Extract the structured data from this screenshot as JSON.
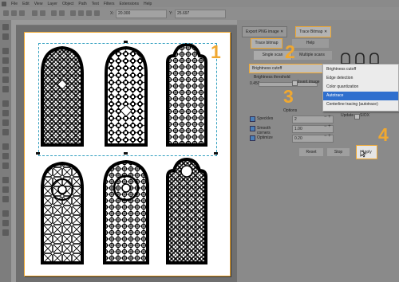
{
  "menu": {
    "items": [
      "File",
      "Edit",
      "View",
      "Layer",
      "Object",
      "Path",
      "Text",
      "Filters",
      "Extensions",
      "Help"
    ]
  },
  "toolbar": {
    "x_label": "X:",
    "x_value": "20.000",
    "y_label": "Y:",
    "y_value": "25.697"
  },
  "panel": {
    "tabs": [
      {
        "label": "Export PNG image",
        "close": "✕"
      },
      {
        "label": "Trace Bitmap",
        "close": "✕"
      }
    ],
    "subtabs": {
      "trace": "Trace bitmap",
      "help": "Help"
    },
    "scan_buttons": {
      "single": "Single scan",
      "multiple": "Multiple scans"
    },
    "mode_selected": "Brightness cutoff",
    "brightness_label": "Brightness threshold",
    "threshold_value": "0.450",
    "invert_label": "Invert image",
    "options_label": "Options",
    "options": [
      {
        "label": "Speckles",
        "value": "2"
      },
      {
        "label": "Smooth corners",
        "value": "1.00"
      },
      {
        "label": "Optimize",
        "value": "0.20"
      }
    ],
    "dropdown_options": [
      "Brightness cutoff",
      "Edge detection",
      "Color quantization",
      "Autotrace",
      "Centerline tracing (autotrace)"
    ],
    "dropdown_selected_index": 3,
    "update_label": "Update",
    "siox_label": "SIOX",
    "reset_label": "Reset",
    "stop_label": "Stop",
    "apply_label": "Apply"
  },
  "steps": [
    "1",
    "2",
    "3",
    "4"
  ],
  "colors": {
    "highlight": "#f0a830",
    "selection": "#2f6fce",
    "window_bg": "#6b6b6b"
  }
}
